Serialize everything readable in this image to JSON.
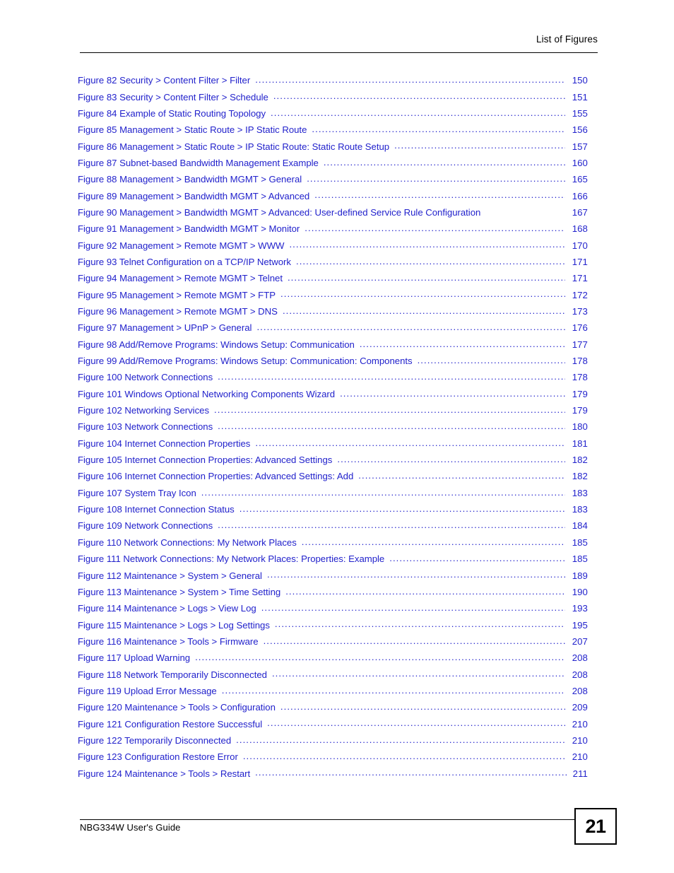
{
  "header": {
    "title": "List of Figures"
  },
  "footer": {
    "guide_title": "NBG334W User's Guide",
    "page_number": "21"
  },
  "colors": {
    "entry_text": "#2222CC",
    "header_text": "#000000",
    "rule": "#000000"
  },
  "toc": {
    "entries": [
      {
        "label": "Figure 82 Security > Content Filter > Filter",
        "page": "150",
        "leader": true
      },
      {
        "label": "Figure 83 Security > Content Filter > Schedule",
        "page": "151",
        "leader": true
      },
      {
        "label": "Figure 84 Example of Static Routing Topology",
        "page": "155",
        "leader": true
      },
      {
        "label": "Figure 85 Management > Static Route > IP Static Route",
        "page": "156",
        "leader": true
      },
      {
        "label": "Figure 86 Management > Static Route > IP Static Route: Static Route Setup",
        "page": "157",
        "leader": true
      },
      {
        "label": "Figure 87 Subnet-based Bandwidth Management Example",
        "page": "160",
        "leader": true
      },
      {
        "label": "Figure 88 Management > Bandwidth MGMT > General",
        "page": "165",
        "leader": true
      },
      {
        "label": "Figure 89 Management > Bandwidth MGMT > Advanced",
        "page": "166",
        "leader": true
      },
      {
        "label": "Figure 90 Management > Bandwidth MGMT > Advanced: User-defined Service Rule Configuration",
        "page": "167",
        "leader": false
      },
      {
        "label": "Figure 91 Management > Bandwidth MGMT > Monitor",
        "page": "168",
        "leader": true
      },
      {
        "label": "Figure 92 Management > Remote MGMT > WWW",
        "page": "170",
        "leader": true
      },
      {
        "label": "Figure 93 Telnet Configuration on a TCP/IP Network",
        "page": "171",
        "leader": true
      },
      {
        "label": "Figure 94 Management > Remote MGMT > Telnet",
        "page": "171",
        "leader": true
      },
      {
        "label": "Figure 95 Management > Remote MGMT > FTP",
        "page": "172",
        "leader": true
      },
      {
        "label": "Figure 96 Management > Remote MGMT > DNS",
        "page": "173",
        "leader": true
      },
      {
        "label": "Figure 97 Management > UPnP > General",
        "page": "176",
        "leader": true
      },
      {
        "label": "Figure 98 Add/Remove Programs: Windows Setup: Communication",
        "page": "177",
        "leader": true
      },
      {
        "label": "Figure 99 Add/Remove Programs: Windows Setup: Communication: Components",
        "page": "178",
        "leader": true
      },
      {
        "label": "Figure 100 Network Connections",
        "page": "178",
        "leader": true
      },
      {
        "label": "Figure 101 Windows Optional Networking Components Wizard",
        "page": "179",
        "leader": true
      },
      {
        "label": "Figure 102 Networking Services",
        "page": "179",
        "leader": true
      },
      {
        "label": "Figure 103 Network Connections",
        "page": "180",
        "leader": true
      },
      {
        "label": "Figure 104 Internet Connection Properties",
        "page": "181",
        "leader": true
      },
      {
        "label": "Figure 105 Internet Connection Properties: Advanced Settings",
        "page": "182",
        "leader": true
      },
      {
        "label": "Figure 106 Internet Connection Properties: Advanced Settings: Add",
        "page": "182",
        "leader": true
      },
      {
        "label": "Figure 107 System Tray Icon",
        "page": "183",
        "leader": true
      },
      {
        "label": "Figure 108 Internet Connection Status",
        "page": "183",
        "leader": true
      },
      {
        "label": "Figure 109 Network Connections",
        "page": "184",
        "leader": true
      },
      {
        "label": "Figure 110 Network Connections: My Network Places",
        "page": "185",
        "leader": true
      },
      {
        "label": "Figure 111 Network Connections: My Network Places: Properties: Example",
        "page": "185",
        "leader": true
      },
      {
        "label": "Figure 112 Maintenance > System > General",
        "page": "189",
        "leader": true
      },
      {
        "label": "Figure 113 Maintenance > System > Time Setting",
        "page": "190",
        "leader": true
      },
      {
        "label": "Figure 114 Maintenance > Logs > View Log",
        "page": "193",
        "leader": true
      },
      {
        "label": "Figure 115 Maintenance > Logs > Log Settings",
        "page": "195",
        "leader": true
      },
      {
        "label": "Figure 116 Maintenance > Tools > Firmware",
        "page": "207",
        "leader": true
      },
      {
        "label": "Figure 117 Upload Warning",
        "page": "208",
        "leader": true
      },
      {
        "label": "Figure 118 Network Temporarily Disconnected",
        "page": "208",
        "leader": true
      },
      {
        "label": "Figure 119 Upload Error Message",
        "page": "208",
        "leader": true
      },
      {
        "label": "Figure 120 Maintenance > Tools > Configuration",
        "page": "209",
        "leader": true
      },
      {
        "label": "Figure 121 Configuration Restore Successful",
        "page": "210",
        "leader": true
      },
      {
        "label": "Figure 122 Temporarily Disconnected",
        "page": "210",
        "leader": true
      },
      {
        "label": "Figure 123 Configuration Restore Error",
        "page": "210",
        "leader": true
      },
      {
        "label": "Figure 124 Maintenance > Tools > Restart",
        "page": "211",
        "leader": true,
        "tight": true
      }
    ]
  }
}
